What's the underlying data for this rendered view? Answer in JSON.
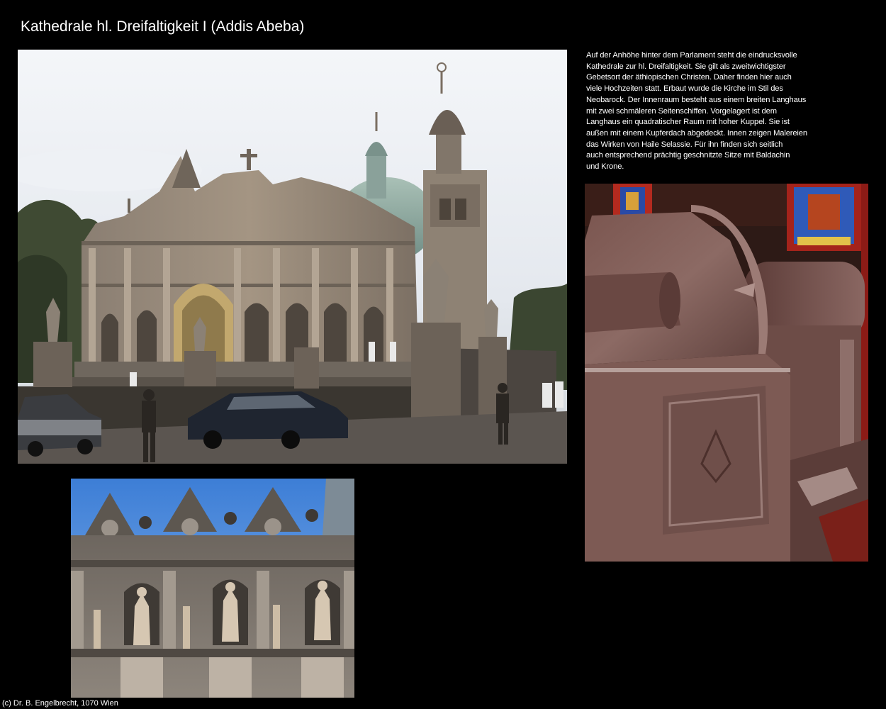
{
  "page": {
    "title": "Kathedrale hl. Dreifaltigkeit I (Addis Abeba)",
    "description": "Auf der Anhöhe hinter dem Parlament steht die eindrucksvolle\nKathedrale zur hl. Dreifaltigkeit. Sie gilt als zweitwichtigster\nGebetsort der äthiopischen Christen. Daher finden hier auch\nviele Hochzeiten statt. Erbaut wurde die Kirche im Stil des\nNeobarock. Der Innenraum besteht aus einem breiten Langhaus\nmit zwei schmäleren Seitenschiffen. Vorgelagert ist dem\nLanghaus ein quadratischer Raum mit hoher Kuppel. Sie ist\naußen mit einem Kupferdach abgedeckt. Innen zeigen Malereien\ndas Wirken von Haile Selassie. Für ihn finden sich seitlich\nauch entsprechend prächtig geschnitzte Sitze mit Baldachin\nund Krone.",
    "copyright": "(c) Dr. B. Engelbrecht, 1070 Wien"
  },
  "colors": {
    "background": "#000000",
    "text": "#ffffff"
  }
}
